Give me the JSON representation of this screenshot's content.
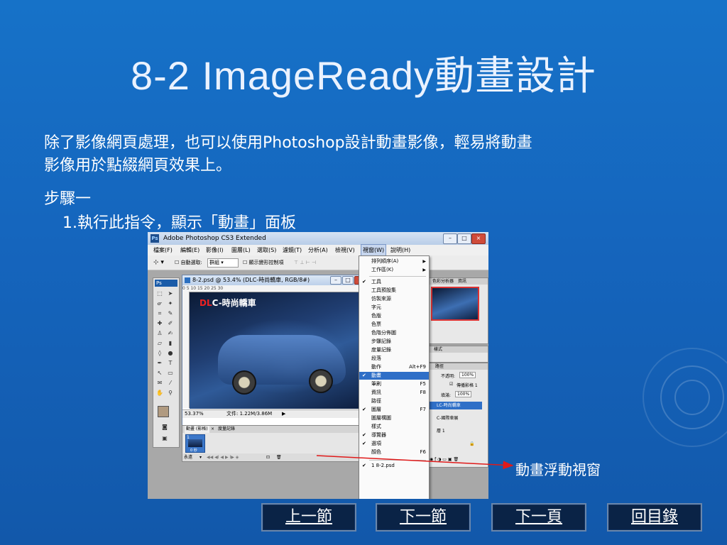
{
  "slide": {
    "title": "8-2  ImageReady動畫設計",
    "body_line1": "除了影像網頁處理，也可以使用Photoshop設計動畫影像，輕易將動畫",
    "body_line2": "影像用於點綴網頁效果上。",
    "step": "步驟一",
    "step_sub": "1.執行此指令，顯示「動畫」面板",
    "callout": "動畫浮動視窗"
  },
  "nav": {
    "prev_section": "上一節",
    "next_section": "下一節",
    "next_page": "下一頁",
    "back_to_toc": "回目錄"
  },
  "colors": {
    "background": "#1565bd",
    "arrow": "#e01a1a",
    "nav_button": "#0a2346",
    "menu_highlight": "#2f6fc7"
  },
  "photoshop": {
    "window_title": "Adobe Photoshop CS3 Extended",
    "logo": "Ps",
    "menubar": [
      "檔案(F)",
      "編輯(E)",
      "影像(I)",
      "圖層(L)",
      "選取(S)",
      "濾鏡(T)",
      "分析(A)",
      "檢視(V)",
      "視窗(W)",
      "說明(H)"
    ],
    "options": {
      "auto_select": "自動選取:",
      "group": "群組",
      "show_transform": "顯示變形控制項"
    },
    "document": {
      "title": "8-2.psd @ 53.4% (DLC-時尚轎車, RGB/8#)",
      "logo_red": "DL",
      "logo_white": "C-時尚轎車",
      "ruler": "0      5      10      15      20      25      30",
      "zoom": "53.37%",
      "file_info": "文件: 1.22M/3.86M"
    },
    "animation_panel": {
      "tab1": "動畫 (影格)",
      "tab2": "度量記錄",
      "frame_number": "1",
      "frame_delay": "0 秒",
      "loop": "永遠"
    },
    "right_panels": {
      "navigator_tabs": [
        "色彩分析器",
        "資訊"
      ],
      "styles_tab": "樣式",
      "paths_tab": "路徑",
      "opacity_label": "不透明:",
      "opacity_value": "100%",
      "fill_label": "填滿:",
      "fill_value": "100%",
      "propagate": "傳播影格 1",
      "layer_selected": "LC-時尚轎車",
      "layer_2": "C-國際車展",
      "layer_3": "層 1"
    },
    "window_menu": [
      {
        "label": "排列順序(A)",
        "submenu": true
      },
      {
        "label": "工作區(K)",
        "submenu": true
      },
      {
        "label": "工具",
        "checked": true
      },
      {
        "label": "工具預設集"
      },
      {
        "label": "仿製來源"
      },
      {
        "label": "字元"
      },
      {
        "label": "色版"
      },
      {
        "label": "色票"
      },
      {
        "label": "色階分佈圖"
      },
      {
        "label": "步驟記錄"
      },
      {
        "label": "度量記錄"
      },
      {
        "label": "段落"
      },
      {
        "label": "動作",
        "shortcut": "Alt+F9"
      },
      {
        "label": "動畫",
        "checked": true,
        "highlight": true
      },
      {
        "label": "筆刷",
        "shortcut": "F5"
      },
      {
        "label": "資訊",
        "shortcut": "F8"
      },
      {
        "label": "路徑"
      },
      {
        "label": "圖層",
        "checked": true,
        "shortcut": "F7"
      },
      {
        "label": "圖層構圖"
      },
      {
        "label": "樣式"
      },
      {
        "label": "導覽器",
        "checked": true
      },
      {
        "label": "選項",
        "checked": true
      },
      {
        "label": "顏色",
        "shortcut": "F6"
      },
      {
        "label": "1 8-2.psd",
        "checked": true
      }
    ]
  }
}
